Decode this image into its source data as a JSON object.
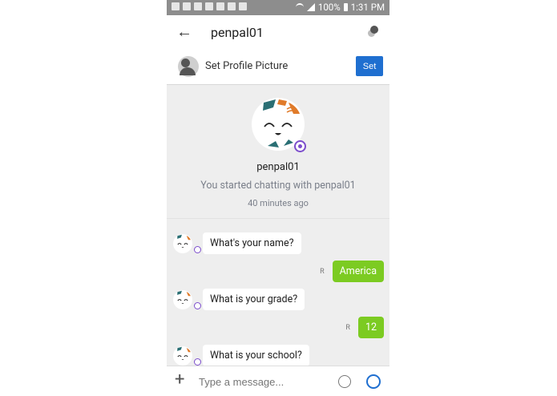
{
  "status": {
    "battery": "100%",
    "time": "1:31 PM"
  },
  "header": {
    "title": "penpal01"
  },
  "profile": {
    "label": "Set Profile Picture",
    "button": "Set"
  },
  "intro": {
    "name": "penpal01",
    "started_text": "You started chatting with penpal01",
    "time_ago": "40 minutes ago"
  },
  "messages": [
    {
      "direction": "in",
      "text": "What's your name?"
    },
    {
      "direction": "out",
      "text": "America",
      "receipt": "R"
    },
    {
      "direction": "in",
      "text": "What is your grade?"
    },
    {
      "direction": "out",
      "text": "12",
      "receipt": "R"
    },
    {
      "direction": "in",
      "text": "What is your school?"
    }
  ],
  "input": {
    "placeholder": "Type a message..."
  },
  "colors": {
    "accent": "#1f6fd0",
    "outgoing": "#7ccb22",
    "statusbar": "#8d8d8d",
    "chat_bg": "#eeeeee"
  }
}
